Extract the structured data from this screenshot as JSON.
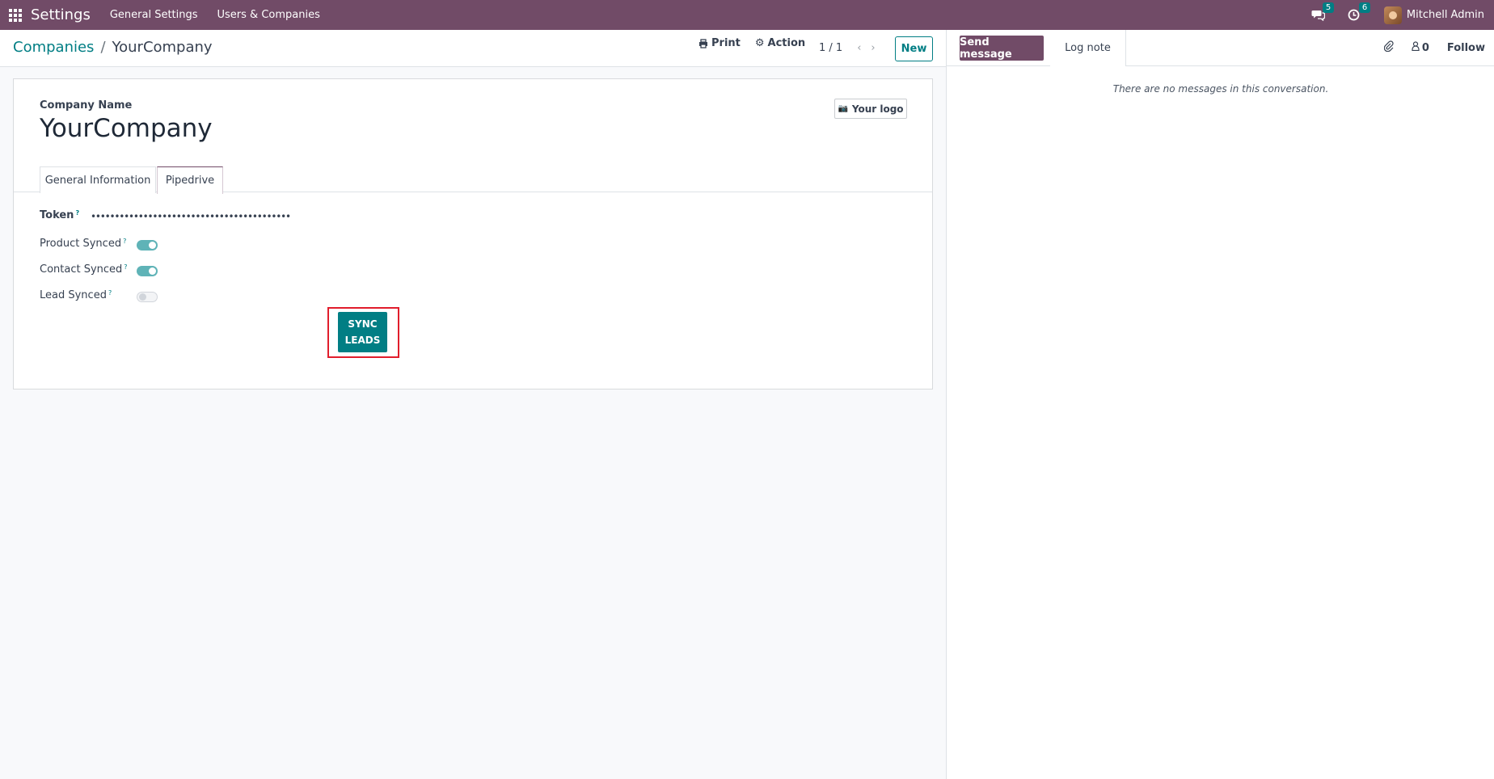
{
  "navbar": {
    "app_title": "Settings",
    "menu": [
      "General Settings",
      "Users & Companies"
    ],
    "messages_count": "5",
    "activities_count": "6",
    "user_name": "Mitchell Admin"
  },
  "control_panel": {
    "breadcrumb_parent": "Companies",
    "breadcrumb_sep": "/",
    "breadcrumb_current": "YourCompany",
    "print_label": "Print",
    "action_label": "Action",
    "pager": "1 / 1",
    "new_label": "New"
  },
  "form": {
    "company_name_label": "Company Name",
    "company_name": "YourCompany",
    "logo_label": "Your logo",
    "tabs": [
      "General Information",
      "Pipedrive"
    ],
    "active_tab": "Pipedrive",
    "token_label": "Token",
    "token_value": "••••••••••••••••••••••••••••••••••••••••••",
    "help_mark": "?",
    "product_synced_label": "Product Synced",
    "product_synced": true,
    "contact_synced_label": "Contact Synced",
    "contact_synced": true,
    "lead_synced_label": "Lead Synced",
    "lead_synced": false,
    "sync_button": "SYNC\nLEADS"
  },
  "chatter": {
    "send_message": "Send message",
    "log_note": "Log note",
    "followers_count": "0",
    "follow": "Follow",
    "empty_text": "There are no messages in this conversation."
  },
  "colors": {
    "navbar": "#714b67",
    "primary": "#017e84",
    "highlight": "#e11d2c"
  }
}
